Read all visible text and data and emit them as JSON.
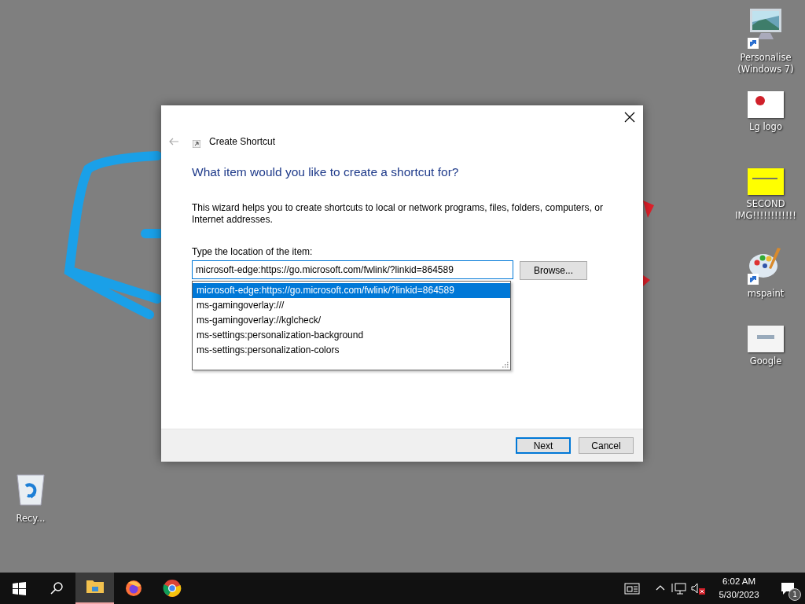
{
  "desktop": {
    "icons": [
      {
        "label": "Personalise\n(Windows 7)",
        "kind": "monitor",
        "shortcut": true
      },
      {
        "label": "Lg logo",
        "kind": "thumbnail",
        "color": "#ffffff"
      },
      {
        "label": "SECOND\nIMG!!!!!!!!!!!!",
        "kind": "thumbnail",
        "color": "#ffff00"
      },
      {
        "label": "mspaint",
        "kind": "palette",
        "shortcut": true
      },
      {
        "label": "Google",
        "kind": "thumbnail",
        "color": "#f4f4f4"
      },
      {
        "label": "Recy...",
        "kind": "recycle-bin",
        "shortcut": false
      }
    ]
  },
  "dialog": {
    "title": "Create Shortcut",
    "heading": "What item would you like to create a shortcut for?",
    "description": "This wizard helps you to create shortcuts to local or network programs, files, folders, computers, or Internet addresses.",
    "location_label": "Type the location of the item:",
    "location_value": "microsoft-edge:https://go.microsoft.com/fwlink/?linkid=864589",
    "suggestions": [
      {
        "text": "microsoft-edge:https://go.microsoft.com/fwlink/?linkid=864589",
        "selected": true
      },
      {
        "text": "ms-gamingoverlay:///",
        "selected": false
      },
      {
        "text": "ms-gamingoverlay://kglcheck/",
        "selected": false
      },
      {
        "text": "ms-settings:personalization-background",
        "selected": false
      },
      {
        "text": "ms-settings:personalization-colors",
        "selected": false
      }
    ],
    "browse_button": "Browse...",
    "buttons": [
      {
        "label": "Next",
        "default": true
      },
      {
        "label": "Cancel",
        "default": false
      }
    ]
  },
  "taskbar": {
    "apps": [
      {
        "kind": "explorer",
        "active": true
      },
      {
        "kind": "firefox",
        "active": false
      },
      {
        "kind": "chrome",
        "active": false
      }
    ],
    "volume_muted": true,
    "time": "6:02 AM",
    "date": "5/30/2023",
    "notification_count": "1"
  }
}
